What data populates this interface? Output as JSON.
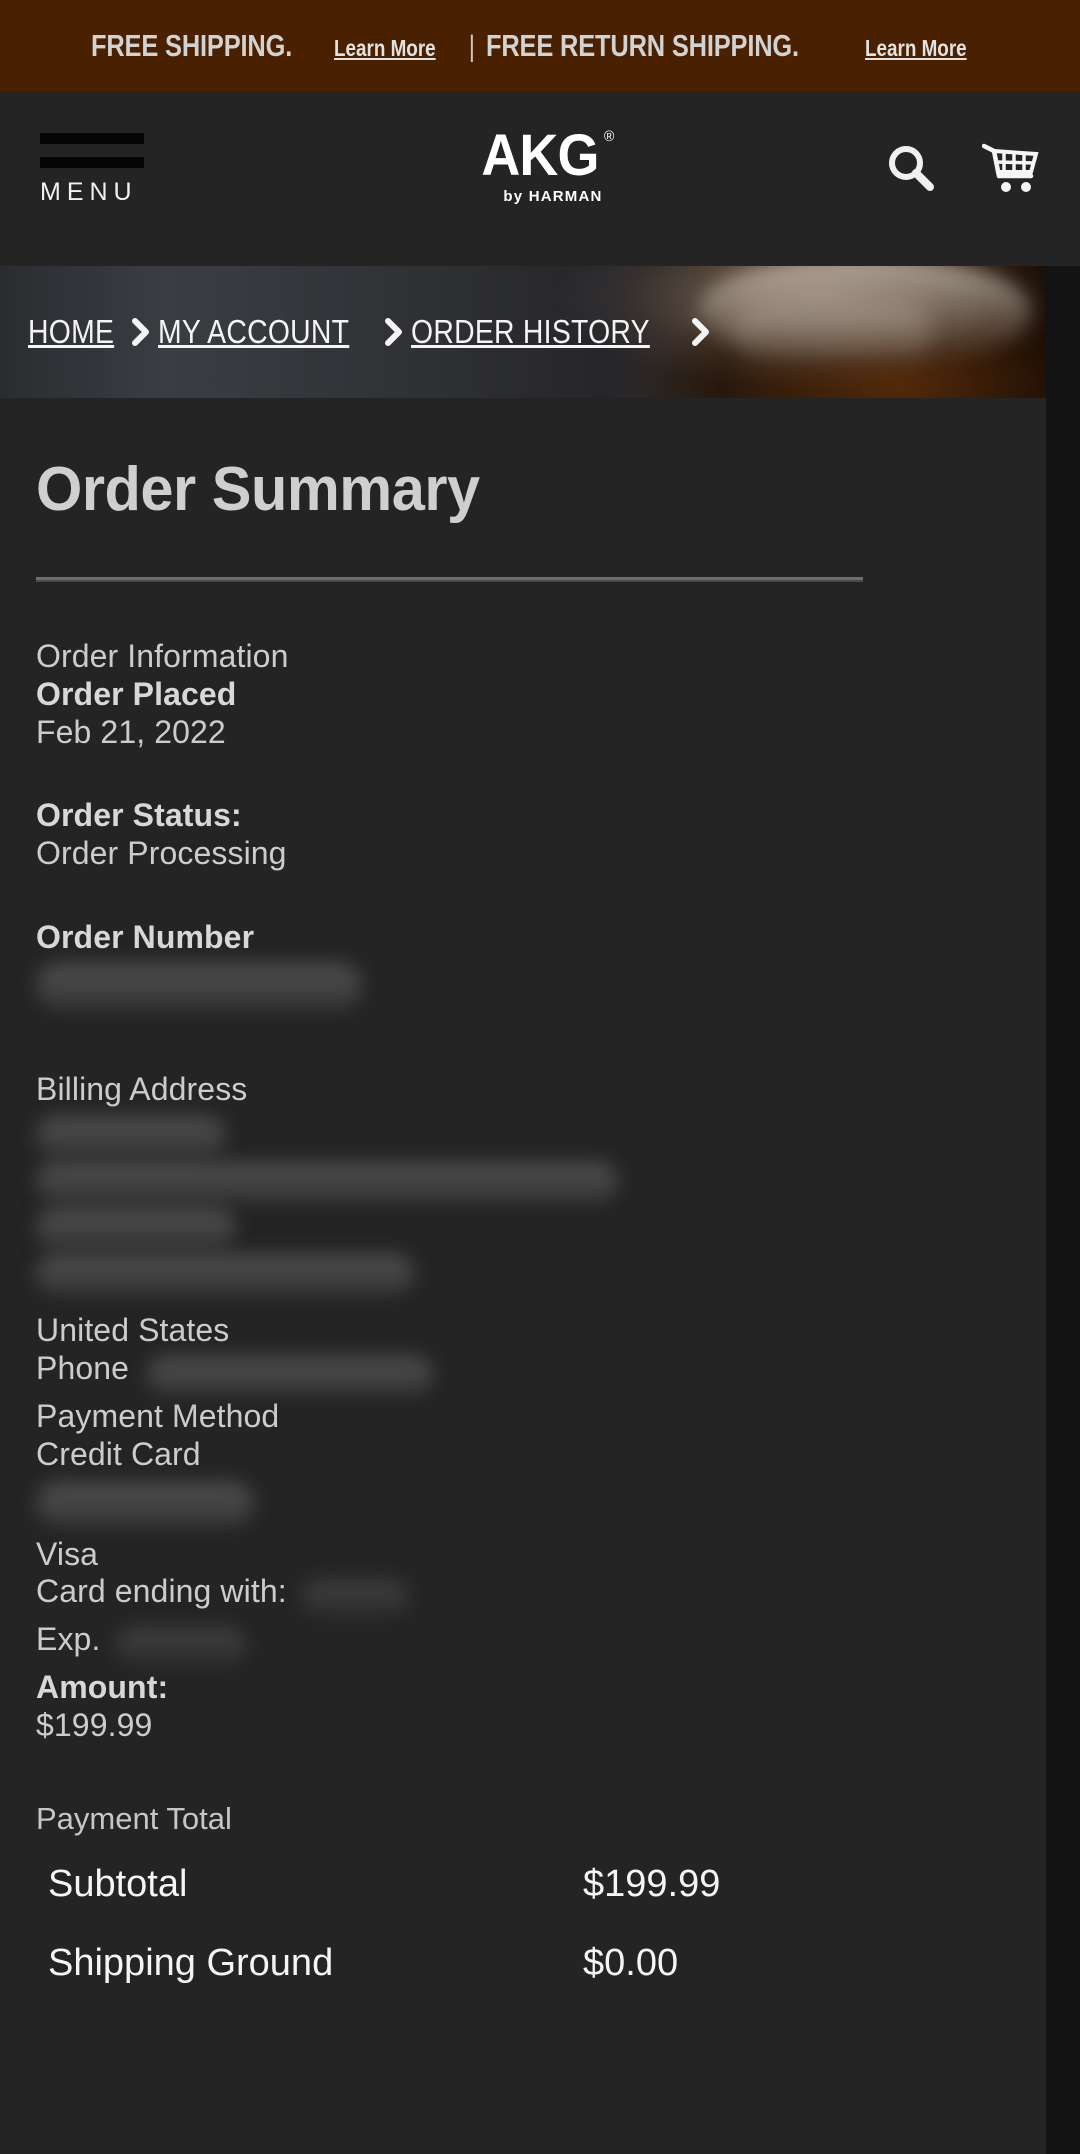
{
  "promo": {
    "message_1": "FREE SHIPPING.",
    "link_1": "Learn More",
    "separator": "|",
    "message_2": "FREE RETURN SHIPPING.",
    "link_2": "Learn More",
    "background_color": "#4a2100"
  },
  "header": {
    "menu_label": "MENU",
    "logo_text": "AKG",
    "logo_registered": "®",
    "logo_subtext": "by HARMAN",
    "search_icon": "search-icon",
    "cart_icon": "shopping-cart-icon",
    "background_color": "#242424"
  },
  "breadcrumb": {
    "items": [
      {
        "label": "HOME"
      },
      {
        "label": "MY ACCOUNT"
      },
      {
        "label": "ORDER HISTORY"
      }
    ],
    "separator_icon": "chevron-right-icon",
    "current_redacted": true
  },
  "main": {
    "page_title": "Order Summary",
    "order_information": {
      "heading": "Order Information",
      "order_placed_label": "Order Placed",
      "order_placed_value": "Feb 21, 2022",
      "order_status_label": "Order Status:",
      "order_status_value": "Order Processing",
      "order_number_label": "Order Number",
      "order_number_value": "[redacted]"
    },
    "billing_address": {
      "heading": "Billing Address",
      "name_redacted": "[redacted]",
      "street_redacted": "[redacted]",
      "city_redacted": "[redacted]",
      "region_redacted": "[redacted]",
      "country": "United States",
      "phone_label": "Phone",
      "phone_value": "[redacted]"
    },
    "payment": {
      "method_label": "Payment Method",
      "method_value": "Credit Card",
      "account_redacted": "[redacted]",
      "card_brand": "Visa",
      "card_ending_label": "Card ending with:",
      "card_ending_value": "[redacted]",
      "expiry_label": "Exp.",
      "expiry_value": "[redacted]",
      "amount_label": "Amount:",
      "amount_value": "$199.99"
    },
    "payment_total": {
      "heading": "Payment Total",
      "rows": [
        {
          "label": "Subtotal",
          "value": "$199.99"
        },
        {
          "label": "Shipping Ground",
          "value": "$0.00"
        }
      ]
    }
  }
}
